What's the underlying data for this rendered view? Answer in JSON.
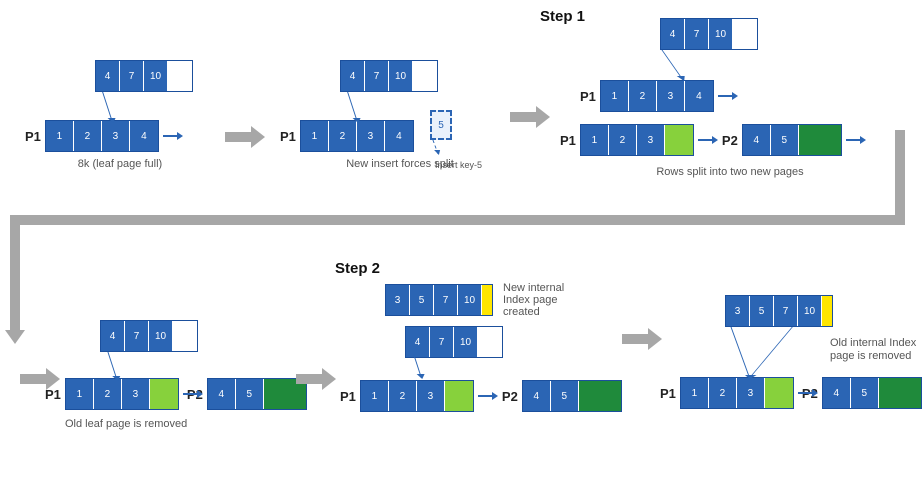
{
  "steps": {
    "step1": "Step 1",
    "step2": "Step 2"
  },
  "panels": {
    "full": {
      "caption": "8k (leaf page full)",
      "p1": "P1",
      "index": [
        "4",
        "7",
        "10"
      ],
      "leaf": [
        "1",
        "2",
        "3",
        "4"
      ]
    },
    "split": {
      "caption": "New insert forces split",
      "p1": "P1",
      "index": [
        "4",
        "7",
        "10"
      ],
      "leaf": [
        "1",
        "2",
        "3",
        "4"
      ],
      "insertKey": "5",
      "insertLabel": "Insert key-5"
    },
    "rows": {
      "caption": "Rows split into two new pages",
      "topIndex": [
        "4",
        "7",
        "10"
      ],
      "p1a": "P1",
      "leafA": [
        "1",
        "2",
        "3",
        "4"
      ],
      "p1b": "P1",
      "leafB": [
        "1",
        "2",
        "3"
      ],
      "p2": "P2",
      "leafC": [
        "4",
        "5"
      ]
    },
    "oldleaf": {
      "caption": "Old leaf page is removed",
      "index": [
        "4",
        "7",
        "10"
      ],
      "p1": "P1",
      "leaf1": [
        "1",
        "2",
        "3"
      ],
      "p2": "P2",
      "leaf2": [
        "4",
        "5"
      ]
    },
    "newidx": {
      "caption": "New internal Index page created",
      "newIndex": [
        "3",
        "5",
        "7",
        "10"
      ],
      "oldIndex": [
        "4",
        "7",
        "10"
      ],
      "p1": "P1",
      "leaf1": [
        "1",
        "2",
        "3"
      ],
      "p2": "P2",
      "leaf2": [
        "4",
        "5"
      ]
    },
    "oldidx": {
      "caption": "Old internal Index page is removed",
      "newIndex": [
        "3",
        "5",
        "7",
        "10"
      ],
      "p1": "P1",
      "leaf1": [
        "1",
        "2",
        "3"
      ],
      "p2": "P2",
      "leaf2": [
        "4",
        "5"
      ]
    }
  }
}
